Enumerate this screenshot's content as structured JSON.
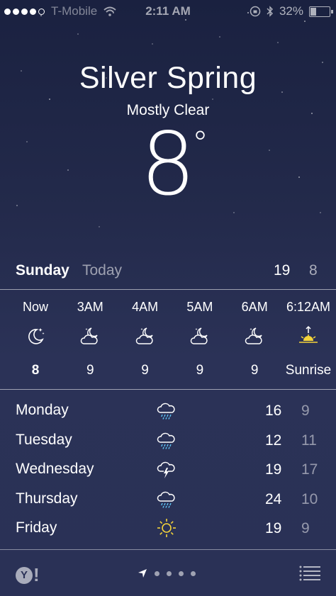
{
  "status_bar": {
    "carrier": "T-Mobile",
    "time": "2:11 AM",
    "battery": "32%",
    "battery_level": 0.32,
    "signal_bars": 4
  },
  "location": {
    "city": "Silver Spring",
    "condition": "Mostly Clear",
    "temperature": "8",
    "degree_symbol": "°"
  },
  "today": {
    "day": "Sunday",
    "label": "Today",
    "high": "19",
    "low": "8"
  },
  "hourly": [
    {
      "time": "Now",
      "icon": "moon-stars-icon",
      "value": "8"
    },
    {
      "time": "3AM",
      "icon": "partly-cloudy-night-icon",
      "value": "9"
    },
    {
      "time": "4AM",
      "icon": "partly-cloudy-night-icon",
      "value": "9"
    },
    {
      "time": "5AM",
      "icon": "partly-cloudy-night-icon",
      "value": "9"
    },
    {
      "time": "6AM",
      "icon": "partly-cloudy-night-icon",
      "value": "9"
    },
    {
      "time": "6:12AM",
      "icon": "sunrise-icon",
      "value": "Sunrise"
    }
  ],
  "daily": [
    {
      "day": "Monday",
      "icon": "rain-icon",
      "high": "16",
      "low": "9"
    },
    {
      "day": "Tuesday",
      "icon": "rain-icon",
      "high": "12",
      "low": "11"
    },
    {
      "day": "Wednesday",
      "icon": "thunderstorm-icon",
      "high": "19",
      "low": "17"
    },
    {
      "day": "Thursday",
      "icon": "rain-icon",
      "high": "24",
      "low": "10"
    },
    {
      "day": "Friday",
      "icon": "sun-icon",
      "high": "19",
      "low": "9"
    }
  ],
  "toolbar": {
    "yahoo_icon": "yahoo-logo-icon",
    "location_icon": "location-arrow-icon",
    "page_count": 4,
    "menu_icon": "list-icon"
  },
  "colors": {
    "background_top": "#1a2140",
    "background_bottom": "#2a3156",
    "sun": "#f5d43a"
  }
}
